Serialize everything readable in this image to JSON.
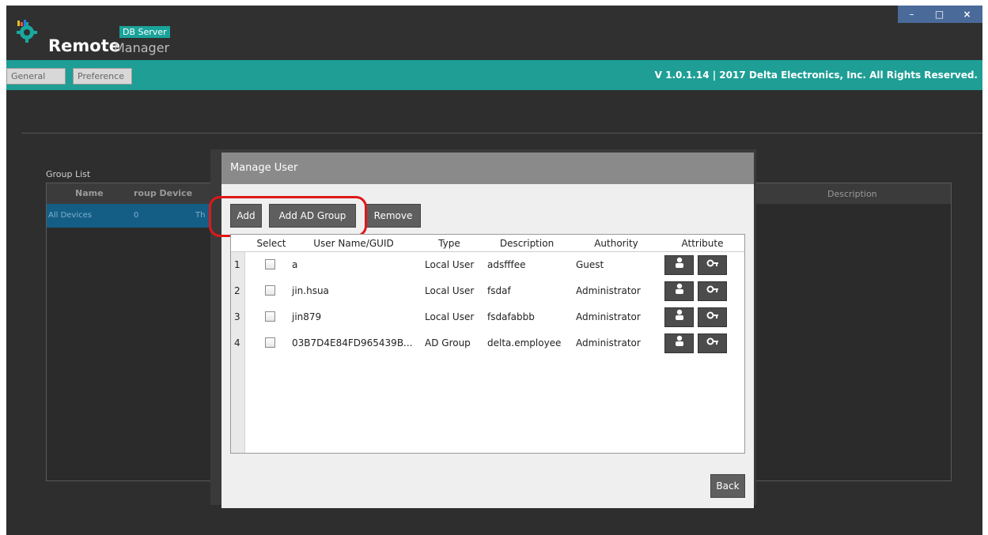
{
  "app": {
    "badge": "DB Server",
    "brand_main": "Remote",
    "brand_sub": "Manager",
    "window_controls": {
      "minimize": "–",
      "maximize": "□",
      "close": "×"
    }
  },
  "toolbar": {
    "tabs": [
      {
        "label": "General"
      },
      {
        "label": "Preference"
      }
    ],
    "version": "V 1.0.1.14  |  2017 Delta Electronics, Inc. All Rights Reserved."
  },
  "background": {
    "group_list_label": "Group List",
    "group_headers": [
      "Name",
      "roup Device"
    ],
    "group_row": {
      "name": "All Devices",
      "count": "0",
      "extra": "Th"
    },
    "description_header": "Description"
  },
  "modal": {
    "title": "Manage User",
    "buttons": {
      "add": "Add",
      "add_ad_group": "Add AD Group",
      "remove": "Remove",
      "back": "Back"
    },
    "columns": [
      "Select",
      "User Name/GUID",
      "Type",
      "Description",
      "Authority",
      "Attribute"
    ],
    "rows": [
      {
        "index": "1",
        "name": "a",
        "type": "Local User",
        "description": "adsfffee",
        "authority": "Guest"
      },
      {
        "index": "2",
        "name": "jin.hsua",
        "type": "Local User",
        "description": "fsdaf",
        "authority": "Administrator"
      },
      {
        "index": "3",
        "name": "jin879",
        "type": "Local User",
        "description": "fsdafabbb",
        "authority": "Administrator"
      },
      {
        "index": "4",
        "name": "03B7D4E84FD965439B...",
        "type": "AD Group",
        "description": "delta.employee",
        "authority": "Administrator"
      }
    ],
    "attribute_icons": [
      "user-icon",
      "key-icon"
    ]
  },
  "colors": {
    "teal": "#1e9e95",
    "highlight": "#e01818",
    "selected_row": "#145e86"
  }
}
